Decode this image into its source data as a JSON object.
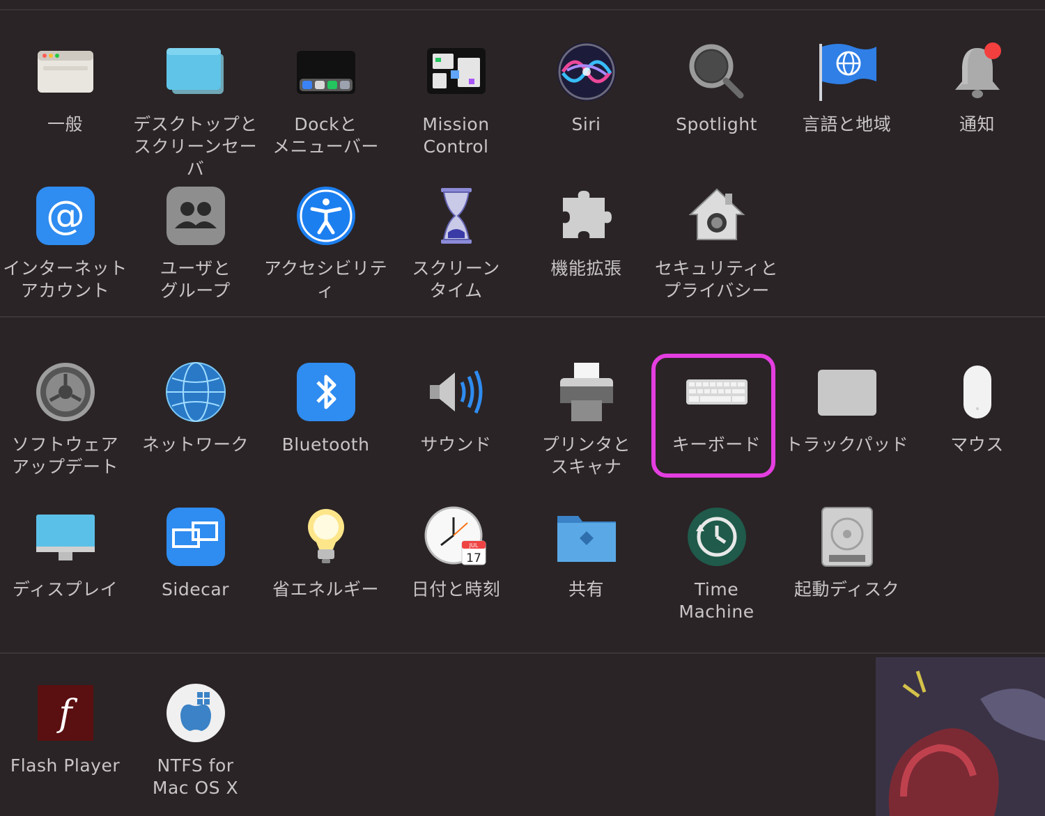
{
  "row1": [
    {
      "name": "general",
      "label": "一般"
    },
    {
      "name": "desktop-screensaver",
      "label": "デスクトップと\nスクリーンセーバ"
    },
    {
      "name": "dock-menubar",
      "label": "Dockと\nメニューバー"
    },
    {
      "name": "mission-control",
      "label": "Mission\nControl"
    },
    {
      "name": "siri",
      "label": "Siri"
    },
    {
      "name": "spotlight",
      "label": "Spotlight"
    },
    {
      "name": "language-region",
      "label": "言語と地域"
    },
    {
      "name": "notifications",
      "label": "通知"
    }
  ],
  "row2": [
    {
      "name": "internet-accounts",
      "label": "インターネット\nアカウント"
    },
    {
      "name": "users-groups",
      "label": "ユーザと\nグループ"
    },
    {
      "name": "accessibility",
      "label": "アクセシビリティ"
    },
    {
      "name": "screen-time",
      "label": "スクリーン\nタイム"
    },
    {
      "name": "extensions",
      "label": "機能拡張"
    },
    {
      "name": "security-privacy",
      "label": "セキュリティと\nプライバシー"
    }
  ],
  "row3": [
    {
      "name": "software-update",
      "label": "ソフトウェア\nアップデート"
    },
    {
      "name": "network",
      "label": "ネットワーク"
    },
    {
      "name": "bluetooth",
      "label": "Bluetooth"
    },
    {
      "name": "sound",
      "label": "サウンド"
    },
    {
      "name": "printers-scanners",
      "label": "プリンタと\nスキャナ"
    },
    {
      "name": "keyboard",
      "label": "キーボード"
    },
    {
      "name": "trackpad",
      "label": "トラックパッド"
    },
    {
      "name": "mouse",
      "label": "マウス"
    }
  ],
  "row4": [
    {
      "name": "displays",
      "label": "ディスプレイ"
    },
    {
      "name": "sidecar",
      "label": "Sidecar"
    },
    {
      "name": "energy-saver",
      "label": "省エネルギー"
    },
    {
      "name": "date-time",
      "label": "日付と時刻"
    },
    {
      "name": "sharing",
      "label": "共有"
    },
    {
      "name": "time-machine",
      "label": "Time\nMachine"
    },
    {
      "name": "startup-disk",
      "label": "起動ディスク"
    }
  ],
  "row5": [
    {
      "name": "flash-player",
      "label": "Flash Player"
    },
    {
      "name": "ntfs-for-mac",
      "label": "NTFS for\nMac OS X"
    }
  ],
  "clock": {
    "month": "JUL",
    "day": "17"
  },
  "highlight_item": "keyboard",
  "colors": {
    "background": "#2a2426",
    "label": "#c9c5c6",
    "highlight": "#e43ee0"
  }
}
